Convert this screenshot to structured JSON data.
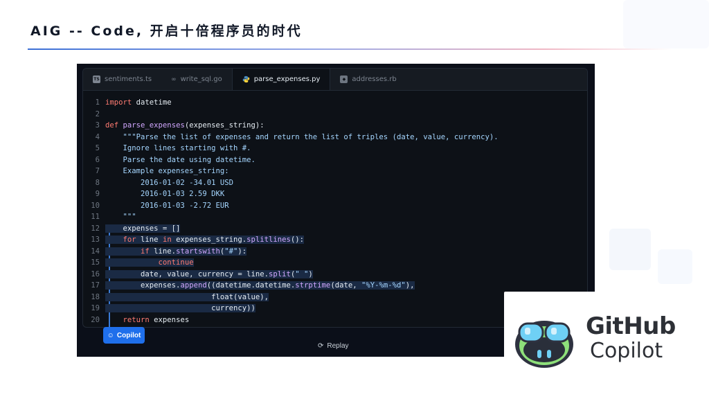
{
  "slide": {
    "title": "AIG -- Code, 开启十倍程序员的时代"
  },
  "colors": {
    "accent": "#1f6feb",
    "editor_bg": "#0d1117",
    "keyword": "#ff7b72",
    "function": "#d2a8ff",
    "string": "#a5d6ff"
  },
  "editor": {
    "tabs": [
      {
        "label": "sentiments.ts",
        "icon": "typescript-icon",
        "active": false
      },
      {
        "label": "write_sql.go",
        "icon": "go-icon",
        "active": false
      },
      {
        "label": "parse_expenses.py",
        "icon": "python-icon",
        "active": true
      },
      {
        "label": "addresses.rb",
        "icon": "ruby-icon",
        "active": false
      }
    ],
    "lines": [
      {
        "n": "1",
        "text": "import datetime"
      },
      {
        "n": "2",
        "text": ""
      },
      {
        "n": "3",
        "text": "def parse_expenses(expenses_string):"
      },
      {
        "n": "4",
        "text": "    \"\"\"Parse the list of expenses and return the list of triples (date, value, currency)."
      },
      {
        "n": "5",
        "text": "    Ignore lines starting with #."
      },
      {
        "n": "6",
        "text": "    Parse the date using datetime."
      },
      {
        "n": "7",
        "text": "    Example expenses_string:"
      },
      {
        "n": "8",
        "text": "        2016-01-02 -34.01 USD"
      },
      {
        "n": "9",
        "text": "        2016-01-03 2.59 DKK"
      },
      {
        "n": "10",
        "text": "        2016-01-03 -2.72 EUR"
      },
      {
        "n": "11",
        "text": "    \"\"\""
      },
      {
        "n": "12",
        "text": "    expenses = []"
      },
      {
        "n": "13",
        "text": "    for line in expenses_string.splitlines():"
      },
      {
        "n": "14",
        "text": "        if line.startswith(\"#\"):"
      },
      {
        "n": "15",
        "text": "            continue"
      },
      {
        "n": "16",
        "text": "        date, value, currency = line.split(\" \")"
      },
      {
        "n": "17",
        "text": "        expenses.append((datetime.datetime.strptime(date, \"%Y-%m-%d\"),"
      },
      {
        "n": "18",
        "text": "                        float(value),"
      },
      {
        "n": "19",
        "text": "                        currency))"
      },
      {
        "n": "20",
        "text": "    return expenses"
      }
    ],
    "copilot_badge": "Copilot",
    "replay_label": "Replay"
  },
  "logo": {
    "title": "GitHub",
    "subtitle": "Copilot",
    "icon": "copilot-mascot-icon"
  }
}
